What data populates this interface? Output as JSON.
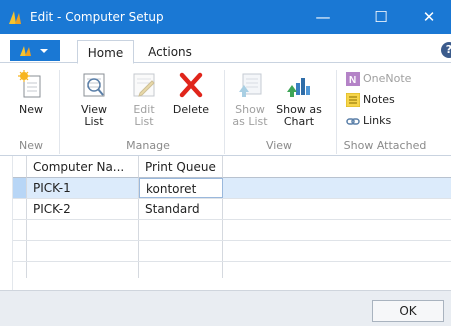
{
  "window": {
    "title": "Edit - Computer Setup",
    "minimize_glyph": "—",
    "maximize_glyph": "☐",
    "close_glyph": "✕",
    "accent": "#1a78d4"
  },
  "ribbon": {
    "tabs": [
      "Home",
      "Actions"
    ],
    "groups": {
      "new": "New",
      "manage": "Manage",
      "view": "View",
      "show_attached": "Show Attached"
    },
    "buttons": {
      "new": "New",
      "view_list_1": "View",
      "view_list_2": "List",
      "edit_list_1": "Edit",
      "edit_list_2": "List",
      "delete": "Delete",
      "show_as_list_1": "Show",
      "show_as_list_2": "as List",
      "show_as_chart_1": "Show as",
      "show_as_chart_2": "Chart",
      "onenote": "OneNote",
      "notes": "Notes",
      "links": "Links"
    },
    "help_glyph": "?"
  },
  "grid": {
    "columns": [
      "Computer Na...",
      "Print Queue"
    ],
    "rows": [
      {
        "computer_name": "PICK-1",
        "print_queue": "kontoret"
      },
      {
        "computer_name": "PICK-2",
        "print_queue": "Standard"
      }
    ]
  },
  "footer": {
    "ok_label": "OK"
  }
}
